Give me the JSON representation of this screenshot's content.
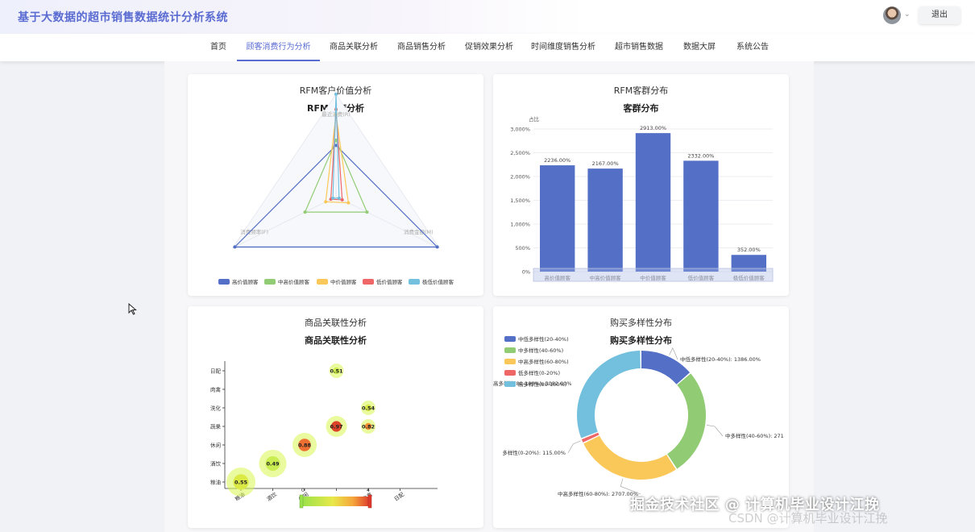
{
  "app": {
    "title": "基于大数据的超市销售数据统计分析系统",
    "logout_label": "退出"
  },
  "nav": {
    "items": [
      {
        "label": "首页"
      },
      {
        "label": "顾客消费行为分析"
      },
      {
        "label": "商品关联分析"
      },
      {
        "label": "商品销售分析"
      },
      {
        "label": "促销效果分析"
      },
      {
        "label": "时间维度销售分析"
      },
      {
        "label": "超市销售数据"
      },
      {
        "label": "数据大屏"
      },
      {
        "label": "系统公告"
      }
    ],
    "active_index": 1
  },
  "cards": {
    "rfm_value": {
      "card_title": "RFM客户价值分析",
      "chart_title": "RFM维度分析"
    },
    "rfm_dist": {
      "card_title": "RFM客群分布",
      "chart_title": "客群分布"
    },
    "assoc": {
      "card_title": "商品关联性分析",
      "chart_title": "商品关联性分析"
    },
    "diversity": {
      "card_title": "购买多样性分布",
      "chart_title": "购买多样性分布"
    }
  },
  "colors": {
    "accent": "#5a6bd1",
    "series": [
      "#5470c6",
      "#91cc75",
      "#fac858",
      "#ee6666",
      "#73c0de"
    ]
  },
  "chart_data": [
    {
      "id": "rfm_radar",
      "type": "radar",
      "indicators": [
        "最近消费(R)",
        "消费金额(M)",
        "消费频率(F)"
      ],
      "series": [
        {
          "name": "高价值顾客",
          "values": [
            0.5,
            0.98,
            0.98
          ]
        },
        {
          "name": "中高价值顾客",
          "values": [
            0.55,
            0.3,
            0.3
          ]
        },
        {
          "name": "中价值顾客",
          "values": [
            0.8,
            0.12,
            0.1
          ]
        },
        {
          "name": "低价值顾客",
          "values": [
            0.85,
            0.06,
            0.05
          ]
        },
        {
          "name": "极低价值顾客",
          "values": [
            1.0,
            0.03,
            0.03
          ]
        }
      ],
      "legend": "bottom"
    },
    {
      "id": "rfm_bar",
      "type": "bar",
      "ylabel": "占比",
      "categories": [
        "高价值顾客",
        "中高价值顾客",
        "中价值顾客",
        "低价值顾客",
        "极低价值顾客"
      ],
      "values": [
        2236,
        2167,
        2913,
        2332,
        352
      ],
      "value_labels": [
        "2236.00%",
        "2167.00%",
        "2913.00%",
        "2332.00%",
        "352.00%"
      ],
      "yticks": [
        "0%",
        "500%",
        "1,000%",
        "1,500%",
        "2,000%",
        "2,500%",
        "3,000%"
      ],
      "ylim": [
        0,
        3000
      ]
    },
    {
      "id": "assoc_bubble",
      "type": "scatter",
      "x_categories": [
        "粮油",
        "酒饮",
        "休闲",
        "蔬果",
        "肉禽",
        "日配"
      ],
      "y_categories": [
        "粮油",
        "酒饮",
        "休闲",
        "蔬果",
        "洗化",
        "肉禽",
        "日配"
      ],
      "x_labels": [
        "粮油",
        "酒饮",
        "休闲",
        "",
        "肉禽",
        "日配"
      ],
      "points": [
        {
          "x": "粮油",
          "y": "粮油",
          "value": 0.55,
          "label": "0.55"
        },
        {
          "x": "酒饮",
          "y": "酒饮",
          "value": 0.49,
          "label": "0.49"
        },
        {
          "x": "休闲",
          "y": "休闲",
          "value": 0.88,
          "label": "0.88"
        },
        {
          "x": "蔬果",
          "y": "蔬果",
          "value": 0.97,
          "label": "0.97"
        },
        {
          "x": "蔬果",
          "y": "日配",
          "value": 0.51,
          "label": "0.51"
        },
        {
          "x": "肉禽",
          "y": "洗化",
          "value": 0.54,
          "label": "0.54"
        },
        {
          "x": "肉禽",
          "y": "蔬果",
          "value": 0.82,
          "label": "0.82"
        }
      ],
      "visual_map": {
        "min": "0",
        "max": "4"
      }
    },
    {
      "id": "diversity_donut",
      "type": "pie",
      "slices": [
        {
          "name": "中低多样性(20-40%)",
          "value": 1386,
          "label": "中低多样性(20-40%): 1386.00%"
        },
        {
          "name": "中多样性(40-60%)",
          "value": 2717,
          "label": "中多样性(40-60%): 271"
        },
        {
          "name": "中高多样性(60-80%)",
          "value": 2707,
          "label": "中高多样性(60-80%): 2707.00%"
        },
        {
          "name": "低多样性(0-20%)",
          "value": 115,
          "label": "多样性(0-20%): 115.00%"
        },
        {
          "name": "高多样性(80-100%)",
          "value": 3082,
          "label": "高多样性(80-100%): 3082.00%"
        }
      ],
      "legend": "top-left"
    }
  ],
  "watermark": {
    "text": "掘金技术社区 @ 计算机毕业设计江挽",
    "text2": "CSDN @计算机毕业设计江挽"
  }
}
